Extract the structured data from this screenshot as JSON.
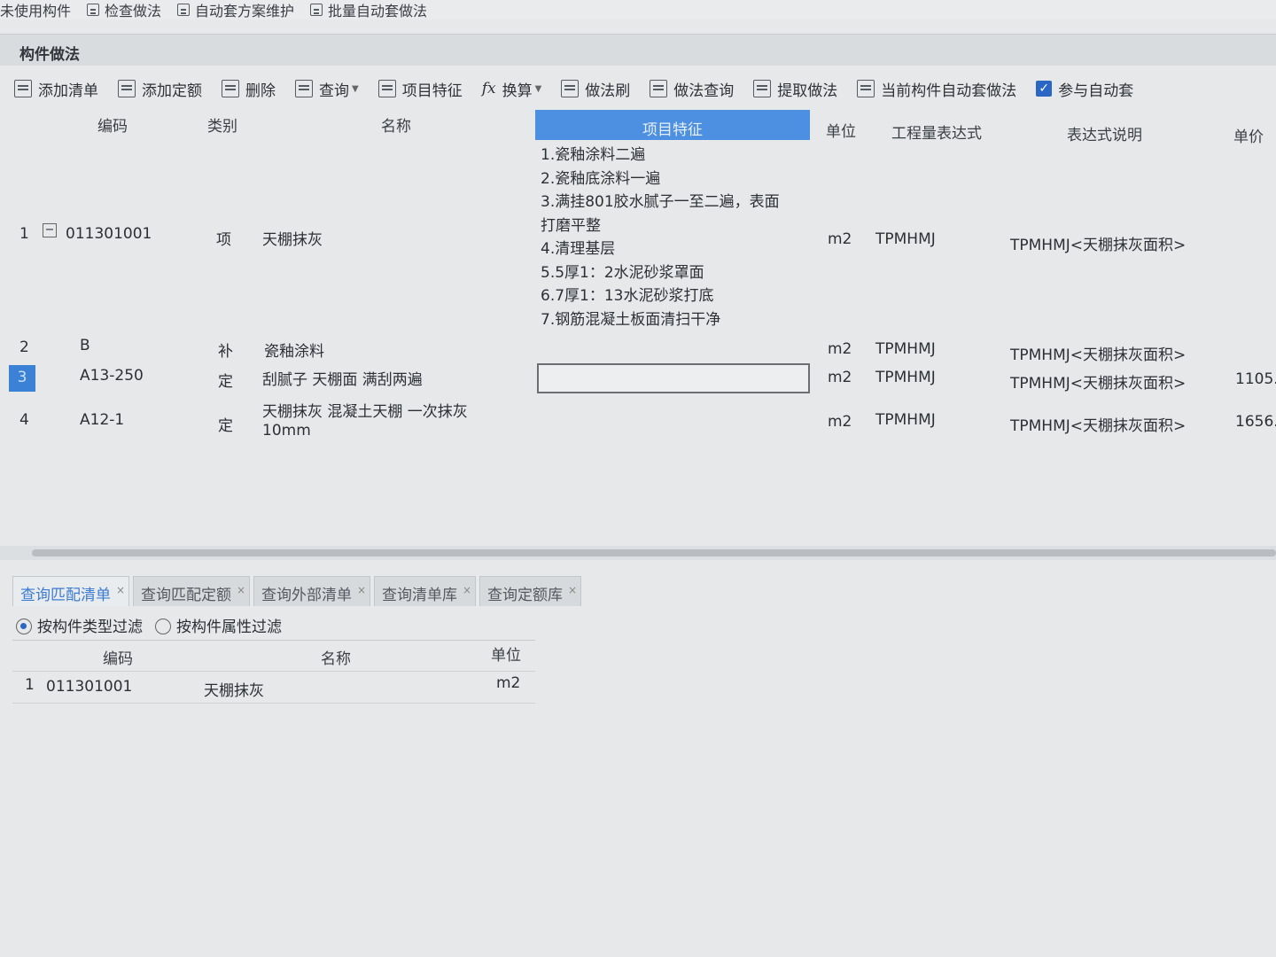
{
  "topbar": {
    "items": [
      "未使用构件",
      "检查做法",
      "自动套方案维护",
      "批量自动套做法"
    ]
  },
  "panel": {
    "title": "构件做法"
  },
  "toolbar": {
    "add_list": "添加清单",
    "add_quota": "添加定额",
    "delete": "删除",
    "query": "查询",
    "item_feature": "项目特征",
    "convert": "换算",
    "method_brush": "做法刷",
    "method_query": "做法查询",
    "extract_method": "提取做法",
    "auto_apply": "当前构件自动套做法",
    "participate_auto": "参与自动套"
  },
  "grid": {
    "headers": {
      "code": "编码",
      "category": "类别",
      "name": "名称",
      "feature": "项目特征",
      "unit": "单位",
      "expression": "工程量表达式",
      "expression_desc": "表达式说明",
      "price": "单价"
    },
    "rows": [
      {
        "num": "1",
        "code": "011301001",
        "category": "项",
        "name": "天棚抹灰",
        "features": [
          "1.瓷釉涂料二遍",
          "2.瓷釉底涂料一遍",
          "3.满挂801胶水腻子一至二遍，表面",
          "打磨平整",
          "4.清理基层",
          "5.5厚1：2水泥砂浆罩面",
          "6.7厚1：13水泥砂浆打底",
          "7.钢筋混凝土板面清扫干净"
        ],
        "unit": "m2",
        "expression": "TPMHMJ",
        "expression_desc": "TPMHMJ<天棚抹灰面积>",
        "price": ""
      },
      {
        "num": "2",
        "code": "B",
        "category": "补",
        "name": "瓷釉涂料",
        "unit": "m2",
        "expression": "TPMHMJ",
        "expression_desc": "TPMHMJ<天棚抹灰面积>",
        "price": ""
      },
      {
        "num": "3",
        "code": "A13-250",
        "category": "定",
        "name": "刮腻子 天棚面 满刮两遍",
        "unit": "m2",
        "expression": "TPMHMJ",
        "expression_desc": "TPMHMJ<天棚抹灰面积>",
        "price": "1105."
      },
      {
        "num": "4",
        "code": "A12-1",
        "category": "定",
        "name_line1": "天棚抹灰 混凝土天棚 一次抹灰",
        "name_line2": "10mm",
        "unit": "m2",
        "expression": "TPMHMJ",
        "expression_desc": "TPMHMJ<天棚抹灰面积>",
        "price": "1656."
      }
    ]
  },
  "bottom": {
    "tabs": [
      "查询匹配清单",
      "查询匹配定额",
      "查询外部清单",
      "查询清单库",
      "查询定额库"
    ],
    "filter_type": "按构件类型过滤",
    "filter_attr": "按构件属性过滤",
    "headers": {
      "code": "编码",
      "name": "名称",
      "unit": "单位"
    },
    "rows": [
      {
        "num": "1",
        "code": "011301001",
        "name": "天棚抹灰",
        "unit": "m2"
      }
    ]
  },
  "colors": {
    "accent": "#3b82d6",
    "header_highlight": "#4d8fe0",
    "checkbox": "#2a66c4"
  }
}
